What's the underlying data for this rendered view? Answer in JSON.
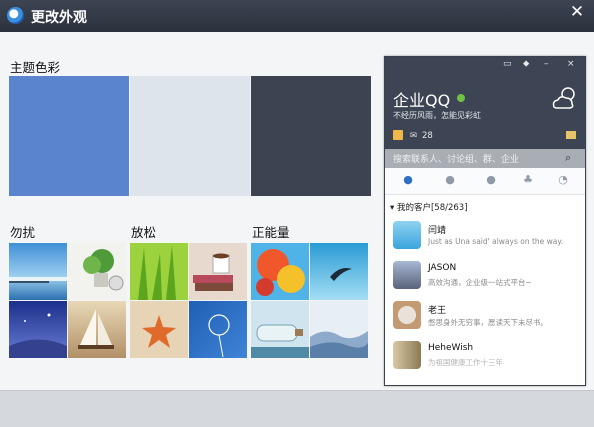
{
  "window": {
    "title": "更改外观",
    "close_glyph": "✕"
  },
  "sections": {
    "theme_color": "主题色彩",
    "quiet": "勿扰",
    "relax": "放松",
    "positive": "正能量"
  },
  "theme_colors": [
    "#5b84ce",
    "#dde4ec",
    "#3c4452"
  ],
  "preview": {
    "controls": [
      "▭",
      "⬥",
      "–",
      "×"
    ],
    "app_name": "企业QQ",
    "signature": "不经历风雨，怎能见彩虹",
    "mail_count": "28",
    "search_placeholder": "搜索联系人、讨论组、群、企业",
    "group_label": "▾ 我的客户[58/263]",
    "contacts": [
      {
        "name": "闫靖",
        "message": "Just as Una said' always on the way."
      },
      {
        "name": "JASON",
        "message": "高效沟通，企业级一站式平台~"
      },
      {
        "name": "老王",
        "message": "憋思身外无穷事，愿读天下未尽书。"
      },
      {
        "name": "HeheWish",
        "message": "为祖国健康工作十三年"
      }
    ]
  }
}
